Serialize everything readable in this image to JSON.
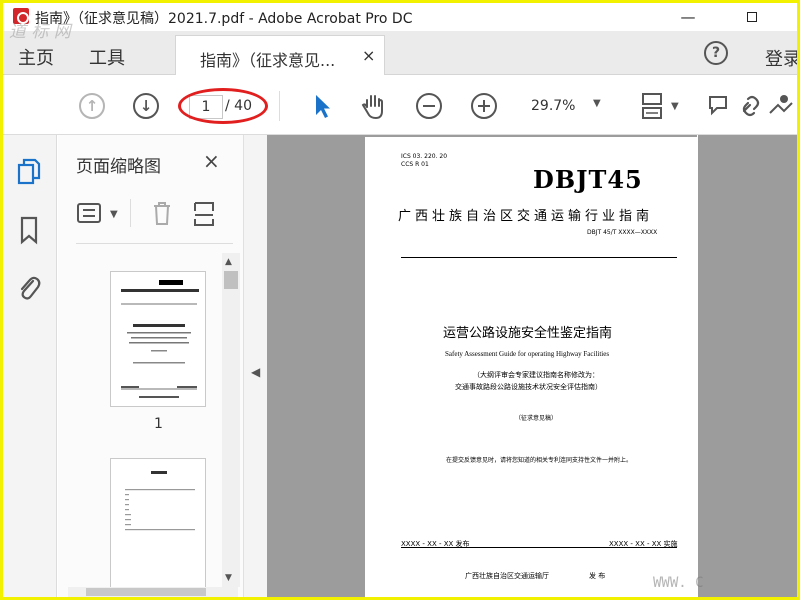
{
  "window": {
    "title": "指南》（征求意见稿）2021.7.pdf - Adobe Acrobat Pro DC",
    "minimize_glyph": "—"
  },
  "menu": {
    "home": "主页",
    "tools": "工具",
    "tab_label": "指南》（征求意见...",
    "tab_close": "×",
    "help": "?",
    "login": "登录"
  },
  "toolbar": {
    "current_page": "1",
    "total_pages": "/ 40",
    "zoom": "29.7%",
    "annotation_color": "#e21f1f"
  },
  "thumbnails": {
    "title": "页面缩略图",
    "close": "×",
    "page_number": "1"
  },
  "document": {
    "ics": "ICS   03. 220. 20",
    "ccs": "CCS  R  01",
    "series": "DBJT45",
    "org": "广西壮族自治区交通运输行业指南",
    "code": "DBJT  45/T  XXXX—XXXX",
    "title": "运营公路设施安全性鉴定指南",
    "title_en": "Safety Assessment Guide for operating Highway Facilities",
    "note1": "（大纲评审会专家建议指南名称修改为：",
    "note2": "交通事故路段公路设施技术状况安全评估指南）",
    "draft": "（征求意见稿）",
    "feedback": "在提交反馈意见时，请将您知道的相关专利连同支持性文件一并附上。",
    "issue_date": "XXXX - XX - XX 发布",
    "impl_date": "XXXX - XX - XX 实施",
    "publisher": "广西壮族自治区交通运输厅",
    "publisher_action": "发  布"
  },
  "watermark": {
    "top_left": "道 标 网",
    "bottom_right": "WWW. C"
  },
  "colors": {
    "accent_blue": "#1a73c8",
    "border_yellow": "#f2f200",
    "canvas_gray": "#9c9c9c"
  }
}
